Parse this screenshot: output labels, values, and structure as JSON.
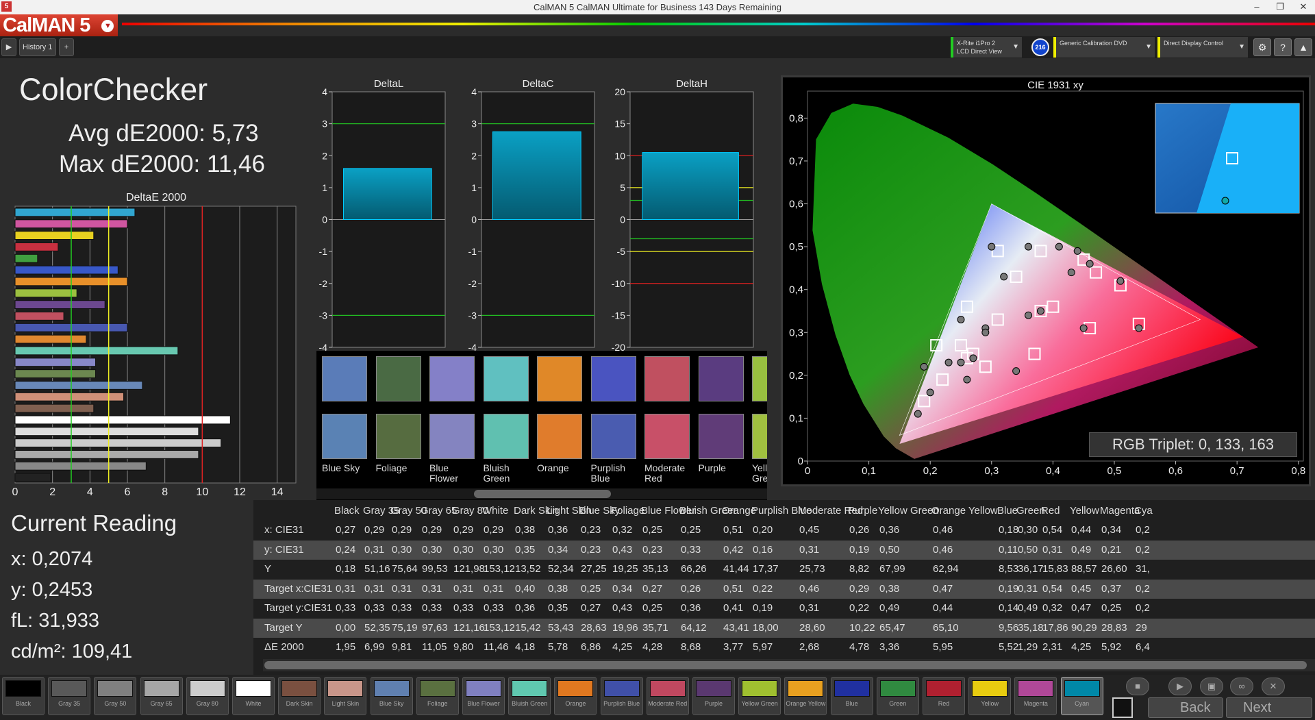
{
  "window": {
    "title": "CalMAN 5 CalMAN Ultimate for Business 143 Days Remaining",
    "app_icon": "5",
    "brand": "CalMAN 5",
    "controls": [
      "–",
      "❒",
      "✕"
    ]
  },
  "toolbar": {
    "tab": "History 1",
    "devices": [
      {
        "line1": "X-Rite i1Pro 2",
        "line2": "LCD Direct View"
      },
      {
        "line1": "Generic Calibration DVD",
        "line2": ""
      },
      {
        "line1": "Direct Display Control",
        "line2": ""
      }
    ],
    "badge": "216"
  },
  "page": {
    "title": "ColorChecker",
    "avg": "Avg dE2000: 5,73",
    "max": "Max dE2000: 11,46"
  },
  "current": {
    "heading": "Current Reading",
    "x": "x: 0,2074",
    "y": "y: 0,2453",
    "fl": "fL: 31,933",
    "cdm": "cd/m²: 109,41"
  },
  "colors": {
    "accent": "#0090b0",
    "bar_top": "#0aa0c4",
    "bar_bottom": "#045a70"
  },
  "delta_e_chart": {
    "title": "DeltaE 2000",
    "xticks": [
      "0",
      "2",
      "4",
      "6",
      "8",
      "10",
      "12",
      "14"
    ]
  },
  "deltaL": {
    "title": "DeltaL",
    "yticks": [
      "4",
      "3",
      "2",
      "1",
      "0",
      "-1",
      "-2",
      "-3",
      "-4"
    ]
  },
  "deltaC": {
    "title": "DeltaC",
    "yticks": [
      "4",
      "3",
      "2",
      "1",
      "0",
      "-1",
      "-2",
      "-3",
      "-4"
    ]
  },
  "deltaH": {
    "title": "DeltaH",
    "yticks": [
      "20",
      "15",
      "10",
      "5",
      "0",
      "-5",
      "-10",
      "-15",
      "-20"
    ]
  },
  "cie": {
    "title": "CIE 1931 xy",
    "xticks": [
      "0",
      "0,1",
      "0,2",
      "0,3",
      "0,4",
      "0,5",
      "0,6",
      "0,7",
      "0,8"
    ],
    "yticks": [
      "0,8",
      "0,7",
      "0,6",
      "0,5",
      "0,4",
      "0,3",
      "0,2",
      "0,1",
      "0"
    ],
    "rgb_triplet": "RGB Triplet: 0, 133, 163"
  },
  "chart_data": [
    {
      "type": "bar",
      "title": "DeltaE 2000",
      "orientation": "horizontal",
      "xlim": [
        0,
        15
      ],
      "thresholds": [
        {
          "value": 3,
          "color": "#22cc22"
        },
        {
          "value": 5,
          "color": "#eeee22"
        },
        {
          "value": 10,
          "color": "#dd2222"
        }
      ],
      "values": [
        6.4,
        6,
        4.2,
        2.3,
        1.2,
        5.5,
        6,
        3.3,
        4.8,
        2.6,
        6,
        3.8,
        8.7,
        4.3,
        4.3,
        6.8,
        5.8,
        4.2,
        11.5,
        9.8,
        11,
        9.8,
        7,
        1.9
      ],
      "colors": [
        "#31a6d0",
        "#d056a0",
        "#e8d020",
        "#c83040",
        "#40a040",
        "#3858c8",
        "#e8902a",
        "#9cc040",
        "#6c4890",
        "#c05060",
        "#4858b0",
        "#e08830",
        "#68c8b0",
        "#8888c8",
        "#6c8850",
        "#6888b8",
        "#d09078",
        "#806050",
        "#ffffff",
        "#dddddd",
        "#cccccc",
        "#aaaaaa",
        "#888888",
        "#222222"
      ]
    },
    {
      "type": "bar",
      "title": "DeltaL",
      "ylim": [
        -4,
        4
      ],
      "values": [
        1.6
      ],
      "reference_lines": [
        3,
        -3
      ]
    },
    {
      "type": "bar",
      "title": "DeltaC",
      "ylim": [
        -4,
        4
      ],
      "values": [
        2.75
      ],
      "reference_lines": [
        3,
        -3
      ]
    },
    {
      "type": "bar",
      "title": "DeltaH",
      "ylim": [
        -20,
        20
      ],
      "values": [
        10.5
      ],
      "reference_lines": [
        10,
        5,
        3,
        -3,
        -5,
        -10
      ]
    },
    {
      "type": "scatter",
      "title": "CIE 1931 xy",
      "xlim": [
        0,
        0.8
      ],
      "ylim": [
        0,
        0.85
      ],
      "gamut_target": [
        [
          0.64,
          0.33
        ],
        [
          0.3,
          0.6
        ],
        [
          0.15,
          0.06
        ]
      ],
      "gamut_measured": [
        [
          0.71,
          0.29
        ],
        [
          0.3,
          0.6
        ],
        [
          0.15,
          0.04
        ]
      ],
      "measured": [
        [
          0.27,
          0.24
        ],
        [
          0.29,
          0.31
        ],
        [
          0.29,
          0.3
        ],
        [
          0.38,
          0.35
        ],
        [
          0.36,
          0.34
        ],
        [
          0.23,
          0.23
        ],
        [
          0.32,
          0.43
        ],
        [
          0.25,
          0.23
        ],
        [
          0.25,
          0.33
        ],
        [
          0.51,
          0.42
        ],
        [
          0.2,
          0.16
        ],
        [
          0.45,
          0.31
        ],
        [
          0.26,
          0.19
        ],
        [
          0.36,
          0.5
        ],
        [
          0.46,
          0.46
        ],
        [
          0.18,
          0.11
        ],
        [
          0.3,
          0.5
        ],
        [
          0.54,
          0.31
        ],
        [
          0.44,
          0.49
        ],
        [
          0.34,
          0.21
        ],
        [
          0.19,
          0.22
        ],
        [
          0.41,
          0.5
        ],
        [
          0.43,
          0.44
        ]
      ],
      "target": [
        [
          0.31,
          0.33
        ],
        [
          0.4,
          0.36
        ],
        [
          0.38,
          0.35
        ],
        [
          0.25,
          0.27
        ],
        [
          0.34,
          0.43
        ],
        [
          0.27,
          0.25
        ],
        [
          0.26,
          0.36
        ],
        [
          0.51,
          0.41
        ],
        [
          0.22,
          0.19
        ],
        [
          0.46,
          0.31
        ],
        [
          0.29,
          0.22
        ],
        [
          0.38,
          0.49
        ],
        [
          0.47,
          0.44
        ],
        [
          0.19,
          0.14
        ],
        [
          0.31,
          0.49
        ],
        [
          0.54,
          0.32
        ],
        [
          0.45,
          0.47
        ],
        [
          0.37,
          0.25
        ],
        [
          0.21,
          0.27
        ],
        [
          0.26,
          0.24
        ]
      ]
    }
  ],
  "swatches": [
    {
      "name": "Blue Sky",
      "top": "#5a7cb8",
      "bottom": "#5a82b4"
    },
    {
      "name": "Foliage",
      "top": "#4a6a44",
      "bottom": "#566c40"
    },
    {
      "name": "Blue Flower",
      "top": "#8480c8",
      "bottom": "#8484c0"
    },
    {
      "name": "Bluish Green",
      "top": "#60c0c0",
      "bottom": "#60c0b0"
    },
    {
      "name": "Orange",
      "top": "#e08828",
      "bottom": "#e07c2c"
    },
    {
      "name": "Purplish Blue",
      "top": "#4a54c0",
      "bottom": "#4a5cb0"
    },
    {
      "name": "Moderate Red",
      "top": "#c05060",
      "bottom": "#c85068"
    },
    {
      "name": "Purple",
      "top": "#5a3c80",
      "bottom": "#603c78"
    },
    {
      "name": "Yellow Green",
      "top": "#98c040",
      "bottom": "#a0c040"
    }
  ],
  "table": {
    "headers": [
      "Black",
      "Gray 35",
      "Gray 50",
      "Gray 65",
      "Gray 80",
      "White",
      "Dark Skin",
      "Light Skin",
      "Blue Sky",
      "Foliage",
      "Blue Flower",
      "Bluish Green",
      "Orange",
      "Purplish Blue",
      "Moderate Red",
      "Purple",
      "Yellow Green",
      "Orange Yellow",
      "Blue",
      "Green",
      "Red",
      "Yellow",
      "Magenta",
      "Cya"
    ],
    "rows": [
      {
        "label": "x: CIE31",
        "cells": [
          "0,27",
          "0,29",
          "0,29",
          "0,29",
          "0,29",
          "0,29",
          "0,38",
          "0,36",
          "0,23",
          "0,32",
          "0,25",
          "0,25",
          "0,51",
          "0,20",
          "0,45",
          "0,26",
          "0,36",
          "0,46",
          "0,18",
          "0,30",
          "0,54",
          "0,44",
          "0,34",
          "0,2"
        ]
      },
      {
        "label": "y: CIE31",
        "cells": [
          "0,24",
          "0,31",
          "0,30",
          "0,30",
          "0,30",
          "0,30",
          "0,35",
          "0,34",
          "0,23",
          "0,43",
          "0,23",
          "0,33",
          "0,42",
          "0,16",
          "0,31",
          "0,19",
          "0,50",
          "0,46",
          "0,11",
          "0,50",
          "0,31",
          "0,49",
          "0,21",
          "0,2"
        ]
      },
      {
        "label": "Y",
        "cells": [
          "0,18",
          "51,16",
          "75,64",
          "99,53",
          "121,98",
          "153,12",
          "13,52",
          "52,34",
          "27,25",
          "19,25",
          "35,13",
          "66,26",
          "41,44",
          "17,37",
          "25,73",
          "8,82",
          "67,99",
          "62,94",
          "8,53",
          "36,17",
          "15,83",
          "88,57",
          "26,60",
          "31,"
        ]
      },
      {
        "label": "Target x:CIE31",
        "cells": [
          "0,31",
          "0,31",
          "0,31",
          "0,31",
          "0,31",
          "0,31",
          "0,40",
          "0,38",
          "0,25",
          "0,34",
          "0,27",
          "0,26",
          "0,51",
          "0,22",
          "0,46",
          "0,29",
          "0,38",
          "0,47",
          "0,19",
          "0,31",
          "0,54",
          "0,45",
          "0,37",
          "0,2"
        ]
      },
      {
        "label": "Target y:CIE31",
        "cells": [
          "0,33",
          "0,33",
          "0,33",
          "0,33",
          "0,33",
          "0,33",
          "0,36",
          "0,35",
          "0,27",
          "0,43",
          "0,25",
          "0,36",
          "0,41",
          "0,19",
          "0,31",
          "0,22",
          "0,49",
          "0,44",
          "0,14",
          "0,49",
          "0,32",
          "0,47",
          "0,25",
          "0,2"
        ]
      },
      {
        "label": "Target Y",
        "cells": [
          "0,00",
          "52,35",
          "75,19",
          "97,63",
          "121,16",
          "153,12",
          "15,42",
          "53,43",
          "28,63",
          "19,96",
          "35,71",
          "64,12",
          "43,41",
          "18,00",
          "28,60",
          "10,22",
          "65,47",
          "65,10",
          "9,56",
          "35,18",
          "17,86",
          "90,29",
          "28,83",
          "29"
        ]
      },
      {
        "label": "ΔE 2000",
        "cells": [
          "1,95",
          "6,99",
          "9,81",
          "11,05",
          "9,80",
          "11,46",
          "4,18",
          "5,78",
          "6,86",
          "4,25",
          "4,28",
          "8,68",
          "3,77",
          "5,97",
          "2,68",
          "4,78",
          "3,36",
          "5,95",
          "5,52",
          "1,29",
          "2,31",
          "4,25",
          "5,92",
          "6,4"
        ]
      }
    ]
  },
  "bottom_swatches": [
    {
      "name": "Black",
      "color": "#000000"
    },
    {
      "name": "Gray 35",
      "color": "#595959"
    },
    {
      "name": "Gray 50",
      "color": "#808080"
    },
    {
      "name": "Gray 65",
      "color": "#a6a6a6"
    },
    {
      "name": "Gray 80",
      "color": "#cccccc"
    },
    {
      "name": "White",
      "color": "#ffffff"
    },
    {
      "name": "Dark Skin",
      "color": "#7a5040"
    },
    {
      "name": "Light Skin",
      "color": "#c8968a"
    },
    {
      "name": "Blue Sky",
      "color": "#6080b0"
    },
    {
      "name": "Foliage",
      "color": "#5a7040"
    },
    {
      "name": "Blue Flower",
      "color": "#8080c0"
    },
    {
      "name": "Bluish Green",
      "color": "#60c8b0"
    },
    {
      "name": "Orange",
      "color": "#e07820"
    },
    {
      "name": "Purplish Blue",
      "color": "#4050a8"
    },
    {
      "name": "Moderate Red",
      "color": "#c04860"
    },
    {
      "name": "Purple",
      "color": "#5a3870"
    },
    {
      "name": "Yellow Green",
      "color": "#a0c030"
    },
    {
      "name": "Orange Yellow",
      "color": "#e8a020"
    },
    {
      "name": "Blue",
      "color": "#2030a0"
    },
    {
      "name": "Green",
      "color": "#308a40"
    },
    {
      "name": "Red",
      "color": "#b02030"
    },
    {
      "name": "Yellow",
      "color": "#e8cc10"
    },
    {
      "name": "Magenta",
      "color": "#b04898"
    },
    {
      "name": "Cyan",
      "color": "#0088a8"
    }
  ],
  "nav": {
    "back": "Back",
    "next": "Next"
  }
}
